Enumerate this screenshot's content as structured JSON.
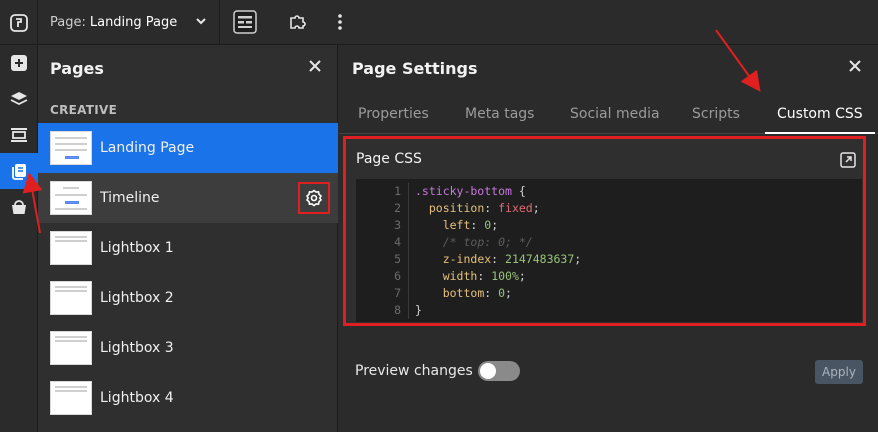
{
  "topbar": {
    "page_prefix": "Page:",
    "page_name": "Landing Page"
  },
  "pages_panel": {
    "title": "Pages",
    "section": "CREATIVE",
    "items": [
      {
        "label": "Landing Page"
      },
      {
        "label": "Timeline"
      },
      {
        "label": "Lightbox 1"
      },
      {
        "label": "Lightbox 2"
      },
      {
        "label": "Lightbox 3"
      },
      {
        "label": "Lightbox 4"
      }
    ]
  },
  "settings": {
    "title": "Page Settings",
    "tabs": [
      {
        "label": "Properties"
      },
      {
        "label": "Meta tags"
      },
      {
        "label": "Social media"
      },
      {
        "label": "Scripts"
      },
      {
        "label": "Custom CSS"
      }
    ],
    "card_title": "Page CSS",
    "code": {
      "line_numbers": [
        "1",
        "2",
        "3",
        "4",
        "5",
        "6",
        "7",
        "8"
      ],
      "selector": ".sticky-bottom",
      "open_brace": " {",
      "close_brace": "}",
      "l2_prop": "position",
      "l2_val": "fixed",
      "l3_prop": "left",
      "l3_val": "0",
      "l4_comment": "/* top: 0; */",
      "l5_prop": "z-index",
      "l5_val": "2147483637",
      "l6_prop": "width",
      "l6_val": "100%",
      "l7_prop": "bottom",
      "l7_val": "0"
    },
    "preview_label": "Preview changes",
    "apply_label": "Apply"
  },
  "colors": {
    "accent": "#1a73e8",
    "highlight": "#e02020"
  }
}
